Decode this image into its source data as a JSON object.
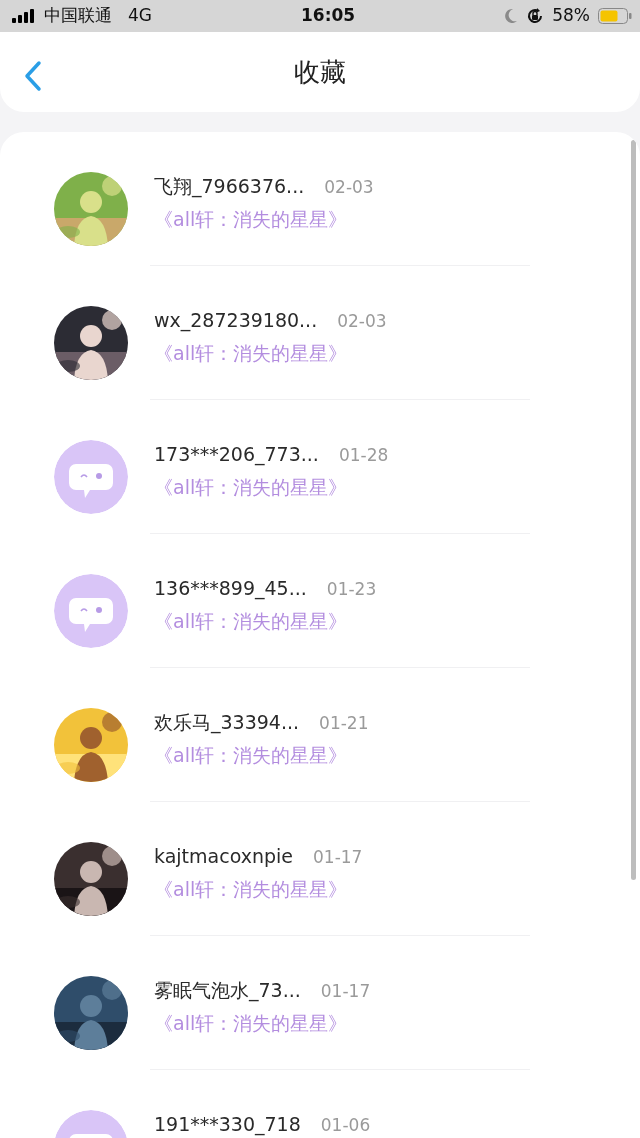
{
  "status_bar": {
    "carrier": "中国联通",
    "network": "4G",
    "time": "16:05",
    "battery": "58%"
  },
  "header": {
    "title": "收藏"
  },
  "favorites": [
    {
      "name": "飞翔_7966376...",
      "date": "02-03",
      "work": "《all轩：消失的星星》"
    },
    {
      "name": "wx_287239180...",
      "date": "02-03",
      "work": "《all轩：消失的星星》"
    },
    {
      "avatar": {
        "kind": "default"
      },
      "name": "173***206_773...",
      "date": "01-28",
      "work": "《all轩：消失的星星》"
    },
    {
      "avatar": {
        "kind": "default"
      },
      "name": "136***899_45...",
      "date": "01-23",
      "work": "《all轩：消失的星星》"
    },
    {
      "name": "欢乐马_33394...",
      "date": "01-21",
      "work": "《all轩：消失的星星》"
    },
    {
      "name": "kajtmacoxnpie",
      "date": "01-17",
      "work": "《all轩：消失的星星》"
    },
    {
      "name": "雾眠气泡水_73...",
      "date": "01-17",
      "work": "《all轩：消失的星星》"
    },
    {
      "avatar": {
        "kind": "default"
      },
      "name": "191***330_718",
      "date": "01-06"
    }
  ]
}
